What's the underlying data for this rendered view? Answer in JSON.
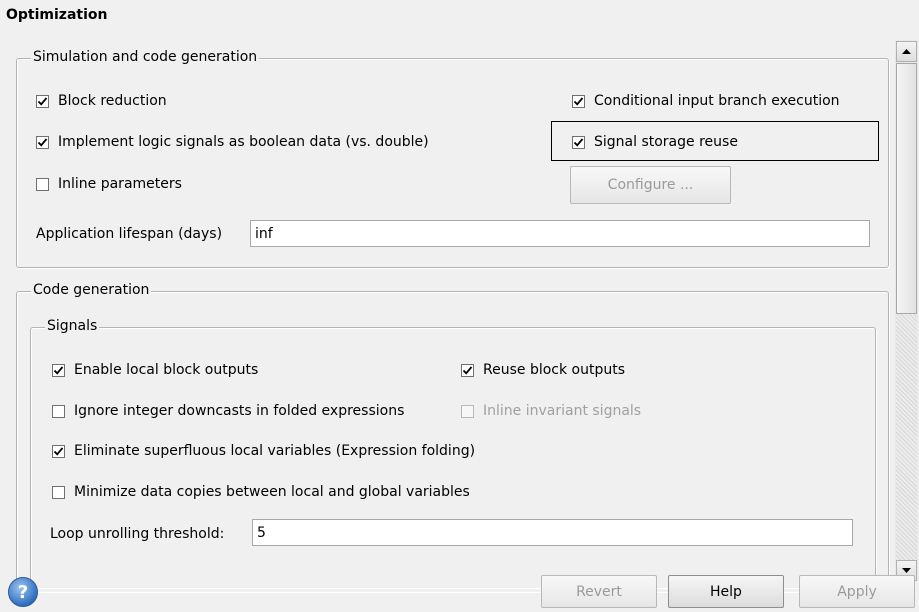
{
  "page": {
    "title": "Optimization"
  },
  "sim_codegen": {
    "legend": "Simulation and code generation",
    "block_reduction": {
      "label": "Block reduction",
      "checked": true
    },
    "conditional_branch": {
      "label": "Conditional input branch execution",
      "checked": true
    },
    "logic_signals": {
      "label": "Implement logic signals as boolean data (vs. double)",
      "checked": true
    },
    "signal_storage_reuse": {
      "label": "Signal storage reuse",
      "checked": true
    },
    "inline_parameters": {
      "label": "Inline parameters",
      "checked": false
    },
    "configure_label": "Configure ...",
    "lifespan_label": "Application lifespan (days)",
    "lifespan_value": "inf"
  },
  "code_generation": {
    "legend": "Code generation",
    "signals": {
      "legend": "Signals",
      "enable_local_outputs": {
        "label": "Enable local block outputs",
        "checked": true
      },
      "reuse_block_outputs": {
        "label": "Reuse block outputs",
        "checked": true
      },
      "ignore_downcasts": {
        "label": "Ignore integer downcasts in folded expressions",
        "checked": false
      },
      "inline_invariant": {
        "label": "Inline invariant signals",
        "checked": false
      },
      "eliminate_locals": {
        "label": "Eliminate superfluous local variables (Expression folding)",
        "checked": true
      },
      "minimize_copies": {
        "label": "Minimize data copies between local and global variables",
        "checked": false
      },
      "loop_label": "Loop unrolling threshold:",
      "loop_value": "5"
    }
  },
  "footer": {
    "revert_label": "Revert",
    "help_label": "Help",
    "apply_label": "Apply",
    "help_icon_glyph": "?"
  }
}
